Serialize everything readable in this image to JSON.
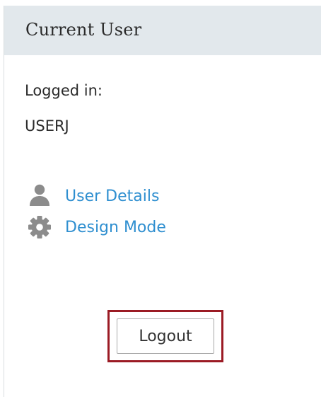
{
  "panel": {
    "title": "Current User"
  },
  "user": {
    "logged_in_label": "Logged in:",
    "username": "USERJ"
  },
  "links": [
    {
      "label": "User Details",
      "icon": "user-icon"
    },
    {
      "label": "Design Mode",
      "icon": "gear-icon"
    }
  ],
  "actions": {
    "logout_label": "Logout"
  },
  "colors": {
    "header_background": "#e2e8ec",
    "link": "#2f8fd0",
    "icon": "#8c8c8c",
    "highlight_border": "#9b1b24"
  }
}
